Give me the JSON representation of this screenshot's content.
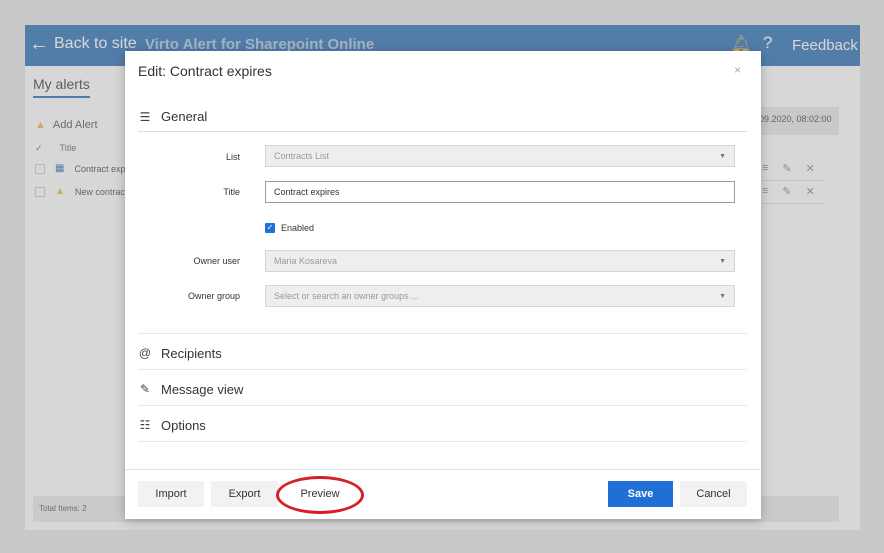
{
  "app": {
    "back_label": "Back to site",
    "title": "Virto Alert for Sharepoint Online",
    "help_label": "?",
    "feedback_label": "Feedback"
  },
  "main": {
    "tab_label": "My alerts",
    "add_alert_label": "Add Alert",
    "column_title": "Title",
    "rows": [
      {
        "title": "Contract exp"
      },
      {
        "title": "New contrac"
      }
    ],
    "date_value": "09.2020, 08:02:00",
    "total_items": "Total Items: 2"
  },
  "modal": {
    "title": "Edit: Contract expires",
    "close_glyph": "×",
    "sections": {
      "general": "General",
      "recipients": "Recipients",
      "message_view": "Message view",
      "options": "Options"
    },
    "fields": {
      "list_label": "List",
      "list_value": "Contracts List",
      "title_label": "Title",
      "title_value": "Contract expires",
      "enabled_label": "Enabled",
      "enabled_checked": true,
      "owner_user_label": "Owner user",
      "owner_user_value": "Maria Kosareva",
      "owner_group_label": "Owner group",
      "owner_group_placeholder": "Select or search an owner groups ..."
    },
    "buttons": {
      "import": "Import",
      "export": "Export",
      "preview": "Preview",
      "save": "Save",
      "cancel": "Cancel"
    }
  },
  "colors": {
    "topbar": "#2a6fb5",
    "primary_button": "#1f6fd6",
    "highlight_ring": "#d42026"
  }
}
